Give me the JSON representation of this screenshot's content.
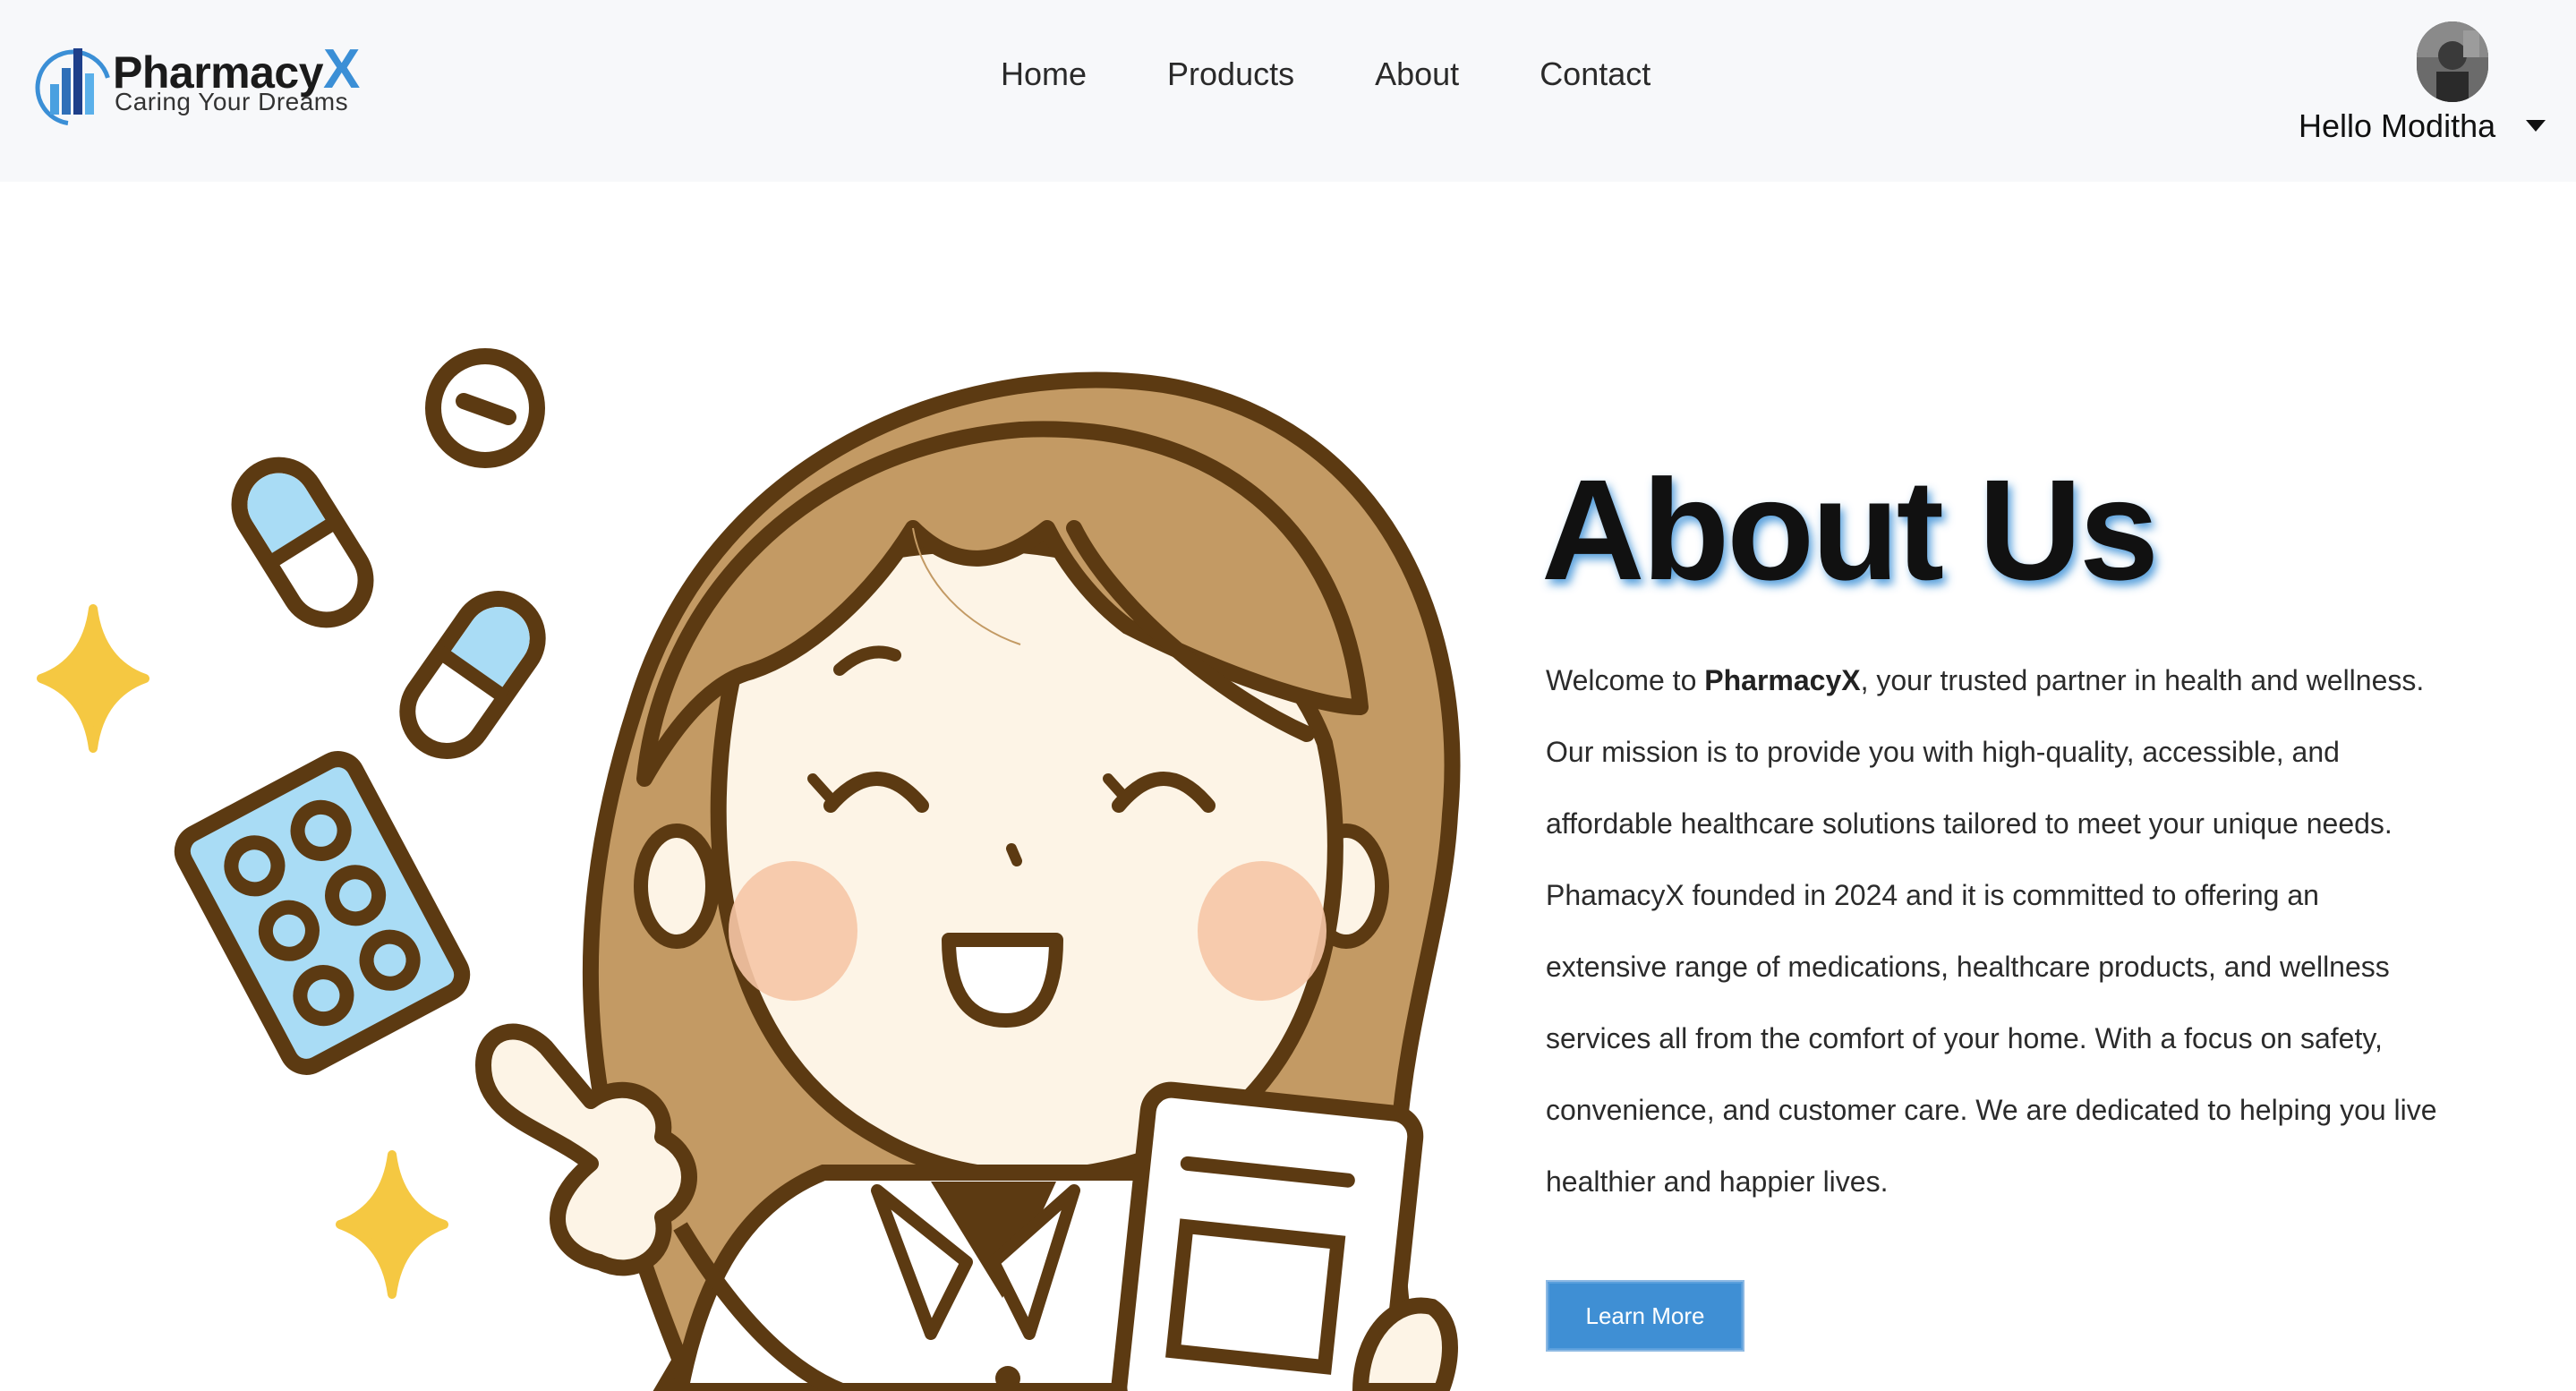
{
  "brand": {
    "name": "Pharmacy",
    "name_accent": "X",
    "tagline": "Caring Your Dreams",
    "accent_color": "#3b8fd6"
  },
  "nav": {
    "links": [
      "Home",
      "Products",
      "About",
      "Contact"
    ]
  },
  "user": {
    "greeting": "Hello Moditha",
    "avatar_icon": "user-avatar-photo",
    "menu_icon": "caret-down-icon"
  },
  "hero": {
    "title": "About Us",
    "body_prefix": "Welcome to ",
    "body_brand": "PharmacyX",
    "body_rest": ", your trusted partner in health and wellness. Our mission is to provide you with high-quality, accessible, and affordable healthcare solutions tailored to meet your unique needs. PhamacyX founded in 2024 and it is committed to offering an extensive range of medications, healthcare products, and wellness services all from the comfort of your home. With a focus on safety, convenience, and customer care. We are dedicated to helping you live healthier and happier lives.",
    "button_label": "Learn More",
    "button_color": "#3f8fd4",
    "illustration": "pharmacist-cartoon-illustration"
  }
}
